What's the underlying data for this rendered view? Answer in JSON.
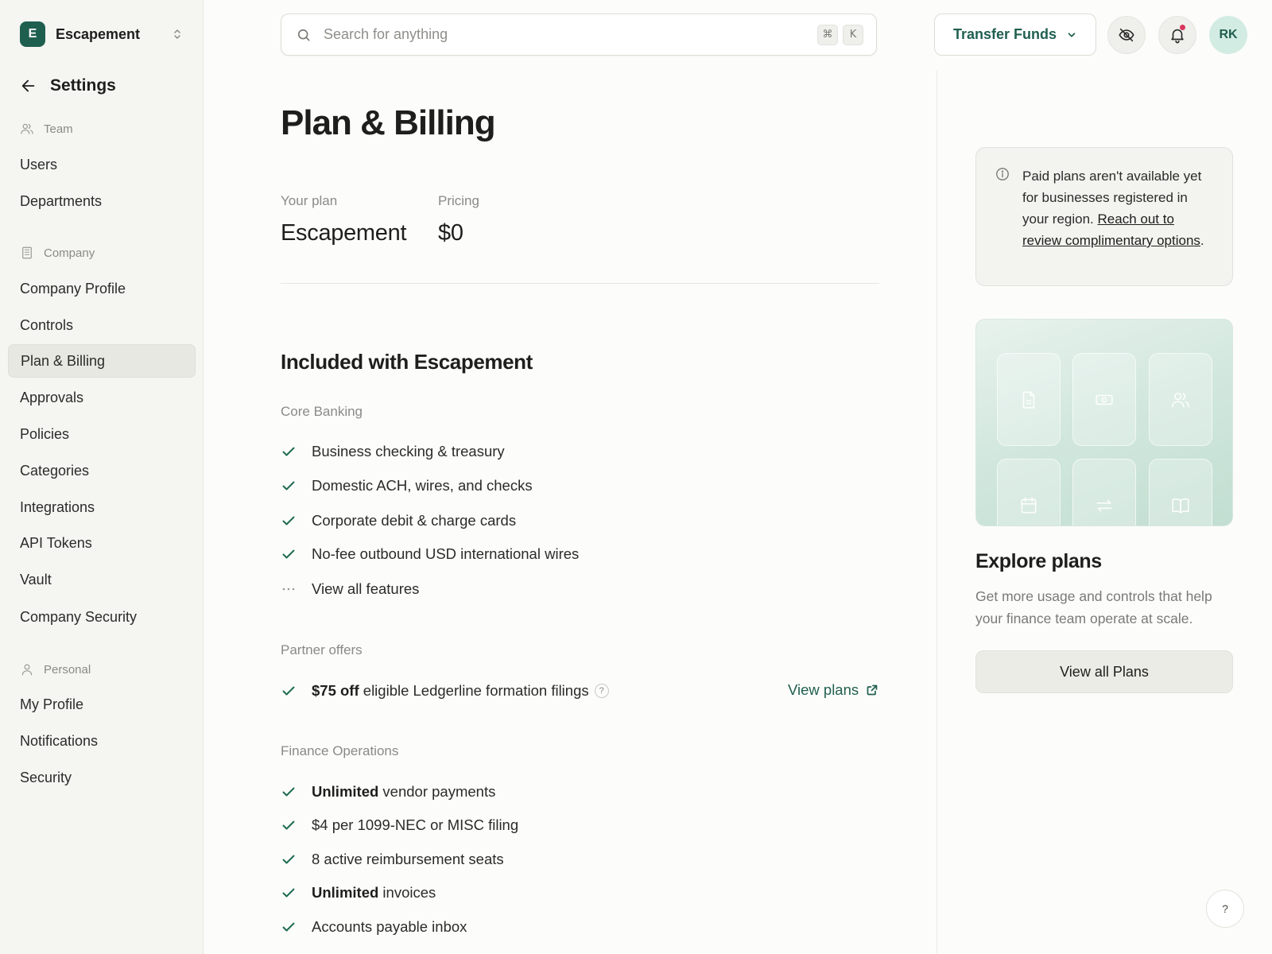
{
  "org": {
    "initial": "E",
    "name": "Escapement"
  },
  "settings": {
    "title": "Settings"
  },
  "sidebar": {
    "team_label": "Team",
    "team_items": [
      "Users",
      "Departments"
    ],
    "company_label": "Company",
    "company_items": [
      "Company Profile",
      "Controls",
      "Plan & Billing",
      "Approvals",
      "Policies",
      "Categories",
      "Integrations",
      "API Tokens",
      "Vault",
      "Company Security"
    ],
    "personal_label": "Personal",
    "personal_items": [
      "My Profile",
      "Notifications",
      "Security"
    ],
    "active_item": "Plan & Billing"
  },
  "topbar": {
    "search_placeholder": "Search for anything",
    "shortcut_keys": [
      "⌘",
      "K"
    ],
    "transfer_label": "Transfer Funds",
    "avatar_initials": "RK"
  },
  "main": {
    "title": "Plan & Billing",
    "plan_label": "Your plan",
    "plan_value": "Escapement",
    "pricing_label": "Pricing",
    "pricing_value": "$0",
    "included_title": "Included with Escapement",
    "core_label": "Core Banking",
    "core_items": [
      "Business checking & treasury",
      "Domestic ACH, wires, and checks",
      "Corporate debit & charge cards",
      "No-fee outbound USD international wires"
    ],
    "view_all_features": "View all features",
    "partner_label": "Partner offers",
    "partner_offer_bold": "$75 off",
    "partner_offer_rest": "eligible Ledgerline formation filings",
    "partner_help": "?",
    "view_plans_link": "View plans",
    "finops_label": "Finance Operations",
    "finops_items": [
      {
        "bold": "Unlimited",
        "text": "vendor payments"
      },
      {
        "bold": "",
        "text": "$4 per 1099-NEC or MISC filing"
      },
      {
        "bold": "",
        "text": "8 active reimbursement seats"
      },
      {
        "bold": "Unlimited",
        "text": "invoices"
      },
      {
        "bold": "",
        "text": "Accounts payable inbox"
      }
    ]
  },
  "right_panel": {
    "notice_text": "Paid plans aren't available yet for businesses registered in your region.",
    "notice_link": "Reach out to review complimentary options",
    "notice_end": ".",
    "explore_title": "Explore plans",
    "explore_desc": "Get more usage and controls that help your finance team operate at scale.",
    "plans_button": "View all Plans"
  },
  "help_fab": "?",
  "colors": {
    "brand": "#1f5f4f",
    "notification_dot": "#d8365b",
    "check": "#1f6b55"
  }
}
